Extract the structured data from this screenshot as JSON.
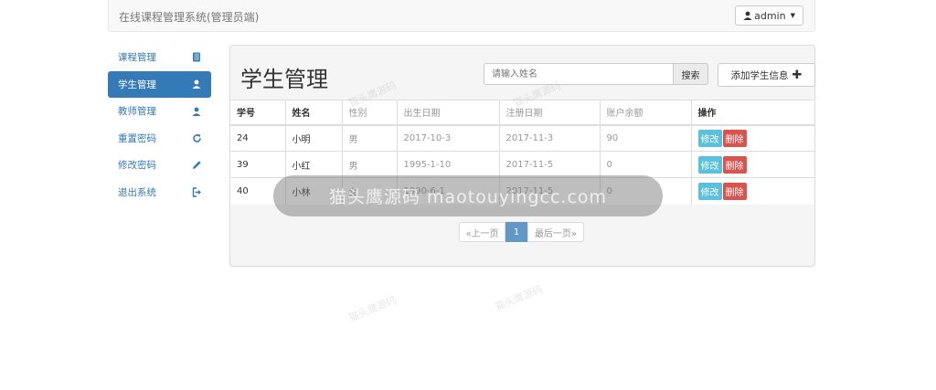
{
  "navbar": {
    "brand": "在线课程管理系统(管理员端)",
    "user": "admin"
  },
  "sidebar": {
    "items": [
      {
        "label": "课程管理",
        "icon": "book-icon",
        "active": false
      },
      {
        "label": "学生管理",
        "icon": "user-icon",
        "active": true
      },
      {
        "label": "教师管理",
        "icon": "user-icon",
        "active": false
      },
      {
        "label": "重置密码",
        "icon": "refresh-icon",
        "active": false
      },
      {
        "label": "修改密码",
        "icon": "pencil-icon",
        "active": false
      },
      {
        "label": "退出系统",
        "icon": "logout-icon",
        "active": false
      }
    ]
  },
  "main": {
    "title": "学生管理",
    "search": {
      "placeholder": "请输入姓名",
      "button": "搜索"
    },
    "add_button": "添加学生信息"
  },
  "table": {
    "headers": [
      "学号",
      "姓名",
      "性别",
      "出生日期",
      "注册日期",
      "账户余额",
      "操作"
    ],
    "rows": [
      {
        "id": "24",
        "name": "小明",
        "gender": "男",
        "birth": "2017-10-3",
        "reg": "2017-11-3",
        "balance": "90"
      },
      {
        "id": "39",
        "name": "小红",
        "gender": "男",
        "birth": "1995-1-10",
        "reg": "2017-11-5",
        "balance": "0"
      },
      {
        "id": "40",
        "name": "小林",
        "gender": "女",
        "birth": "1990-6-1",
        "reg": "2017-11-5",
        "balance": "0"
      }
    ],
    "edit_label": "修改",
    "delete_label": "删除"
  },
  "pagination": {
    "prev": "«上一页",
    "current": "1",
    "last": "最后一页»"
  },
  "watermark": {
    "main": "猫头鹰源码 maotouyingcc.com",
    "faint": "猫头鹰源码"
  },
  "colors": {
    "primary": "#337ab7",
    "info": "#5bc0de",
    "danger": "#d9534f"
  }
}
